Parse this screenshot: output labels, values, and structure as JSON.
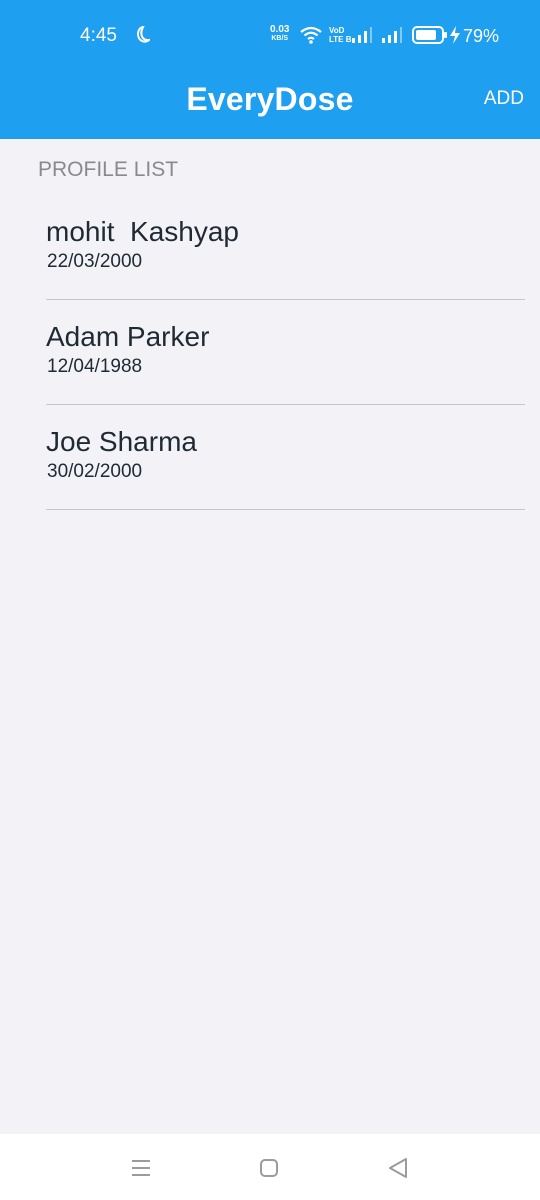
{
  "status_bar": {
    "time": "4:45",
    "net_speed": "0.03",
    "net_unit": "KB/S",
    "volte_top": "VoD",
    "volte_bottom": "LTE B",
    "battery_pct": "79%"
  },
  "app_bar": {
    "title": "EveryDose",
    "add_label": "ADD",
    "background": "#1f9ff0"
  },
  "section": {
    "header": "PROFILE LIST"
  },
  "profiles": [
    {
      "name": "mohit  Kashyap",
      "dob": "22/03/2000"
    },
    {
      "name": "Adam Parker",
      "dob": "12/04/1988"
    },
    {
      "name": "Joe Sharma",
      "dob": "30/02/2000"
    }
  ],
  "nav_bar": {
    "icons": [
      "menu-icon",
      "home-icon",
      "back-icon"
    ]
  }
}
